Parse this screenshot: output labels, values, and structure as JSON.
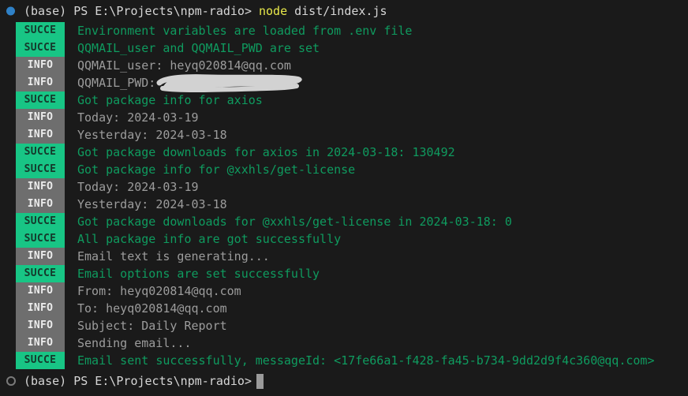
{
  "terminal": {
    "background_color": "#1a1a1a",
    "command_line": {
      "gutter_icon": "filled-circle-icon",
      "prompt": "(base) PS E:\\Projects\\npm-radio>",
      "command_keyword": "node",
      "command_args": "dist/index.js"
    },
    "log_lines": [
      {
        "level": "SUCCE",
        "type": "succ",
        "message": "Environment variables are loaded from .env file"
      },
      {
        "level": "SUCCE",
        "type": "succ",
        "message": "QQMAIL_user and QQMAIL_PWD are set"
      },
      {
        "level": "INFO",
        "type": "info",
        "message": "QQMAIL_user: heyq020814@qq.com"
      },
      {
        "level": "INFO",
        "type": "info",
        "message": "QQMAIL_PWD: "
      },
      {
        "level": "SUCCE",
        "type": "succ",
        "message": "Got package info for axios"
      },
      {
        "level": "INFO",
        "type": "info",
        "message": "Today: 2024-03-19"
      },
      {
        "level": "INFO",
        "type": "info",
        "message": "Yesterday: 2024-03-18"
      },
      {
        "level": "SUCCE",
        "type": "succ",
        "message": "Got package downloads for axios in 2024-03-18: 130492"
      },
      {
        "level": "SUCCE",
        "type": "succ",
        "message": "Got package info for @xxhls/get-license"
      },
      {
        "level": "INFO",
        "type": "info",
        "message": "Today: 2024-03-19"
      },
      {
        "level": "INFO",
        "type": "info",
        "message": "Yesterday: 2024-03-18"
      },
      {
        "level": "SUCCE",
        "type": "succ",
        "message": "Got package downloads for @xxhls/get-license in 2024-03-18: 0"
      },
      {
        "level": "SUCCE",
        "type": "succ",
        "message": "All package info are got successfully"
      },
      {
        "level": "INFO",
        "type": "info",
        "message": "Email text is generating..."
      },
      {
        "level": "SUCCE",
        "type": "succ",
        "message": "Email options are set successfully"
      },
      {
        "level": "INFO",
        "type": "info",
        "message": "From: heyq020814@qq.com"
      },
      {
        "level": "INFO",
        "type": "info",
        "message": "To: heyq020814@qq.com"
      },
      {
        "level": "INFO",
        "type": "info",
        "message": "Subject: Daily Report"
      },
      {
        "level": "INFO",
        "type": "info",
        "message": "Sending email..."
      },
      {
        "level": "SUCCE",
        "type": "succ",
        "message": "Email sent successfully, messageId: <17fe66a1-f428-fa45-b734-9dd2d9f4c360@qq.com>"
      }
    ],
    "final_prompt": {
      "gutter_icon": "hollow-circle-icon",
      "prompt": "(base) PS E:\\Projects\\npm-radio>",
      "cursor": "block-cursor"
    },
    "redaction": {
      "label": "redaction-scribble",
      "color": "#d3d3d3"
    },
    "colors": {
      "success_badge_bg": "#18c585",
      "success_text": "#0f9b5f",
      "info_badge_bg": "#6e6e6e",
      "info_text": "#9c9c9c",
      "prompt_text": "#d6d6d6",
      "keyword": "#e8e84a",
      "gutter_dot": "#2f81c7"
    }
  }
}
